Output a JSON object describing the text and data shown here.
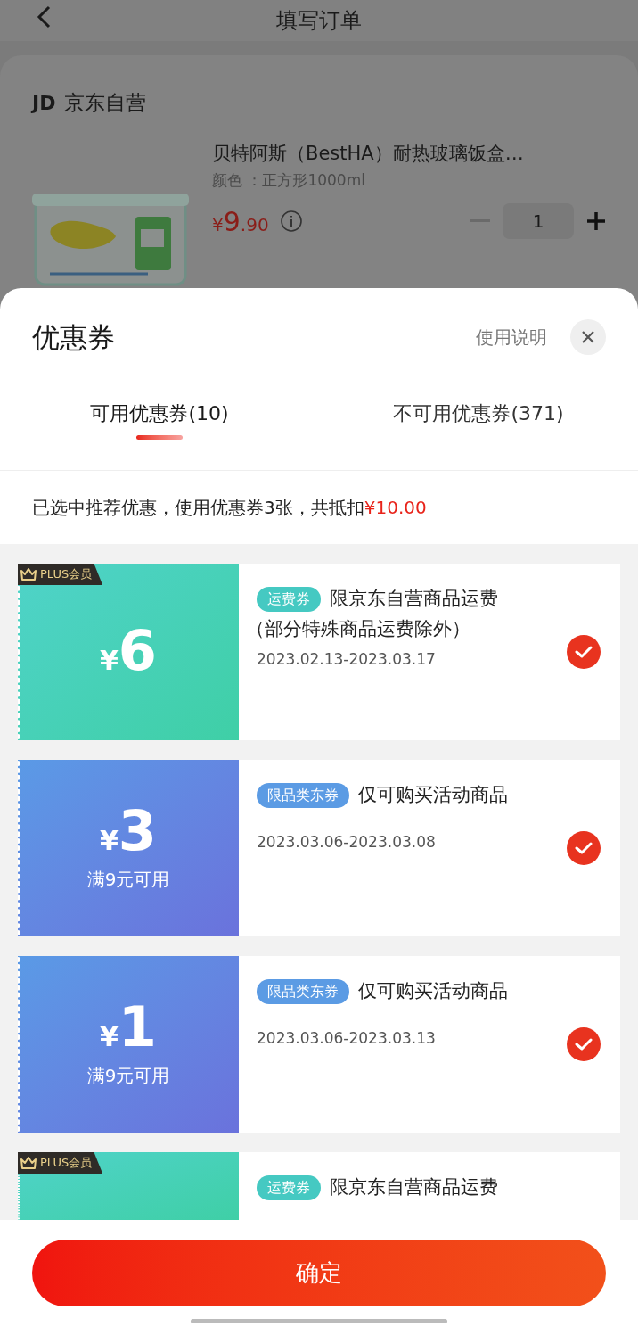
{
  "header": {
    "title": "填写订单"
  },
  "store": {
    "logo": "JD",
    "name": "京东自营"
  },
  "product": {
    "title": "贝特阿斯（BestHA）耐热玻璃饭盒…",
    "spec": "颜色 ：正方形1000ml",
    "currency": "¥",
    "price_int": "9",
    "price_dec": ".90",
    "quantity": "1"
  },
  "sheet": {
    "title": "优惠券",
    "help": "使用说明"
  },
  "tabs": [
    {
      "label": "可用优惠券(10)",
      "selected": true
    },
    {
      "label": "不可用优惠券(371)",
      "selected": false
    }
  ],
  "summary": {
    "text": "已选中推荐优惠，使用优惠券3张，共抵扣",
    "amount": "¥10.00"
  },
  "coupons": [
    {
      "kind": "shipping",
      "plus": true,
      "plus_label": "PLUS会员",
      "currency": "¥",
      "amount": "6",
      "tag": "运费券",
      "title": "限京东自营商品运费",
      "subtitle": "（部分特殊商品运费除外）",
      "dates": "2023.02.13-2023.03.17",
      "selected": true
    },
    {
      "kind": "category",
      "plus": false,
      "currency": "¥",
      "amount": "3",
      "condition": "满9元可用",
      "tag": "限品类东券",
      "title": "仅可购买活动商品",
      "dates": "2023.03.06-2023.03.08",
      "selected": true
    },
    {
      "kind": "category",
      "plus": false,
      "currency": "¥",
      "amount": "1",
      "condition": "满9元可用",
      "tag": "限品类东券",
      "title": "仅可购买活动商品",
      "dates": "2023.03.06-2023.03.13",
      "selected": true
    },
    {
      "kind": "shipping",
      "plus": true,
      "plus_label": "PLUS会员",
      "tag": "运费券",
      "title": "限京东自营商品运费"
    }
  ],
  "confirm": {
    "label": "确定"
  }
}
